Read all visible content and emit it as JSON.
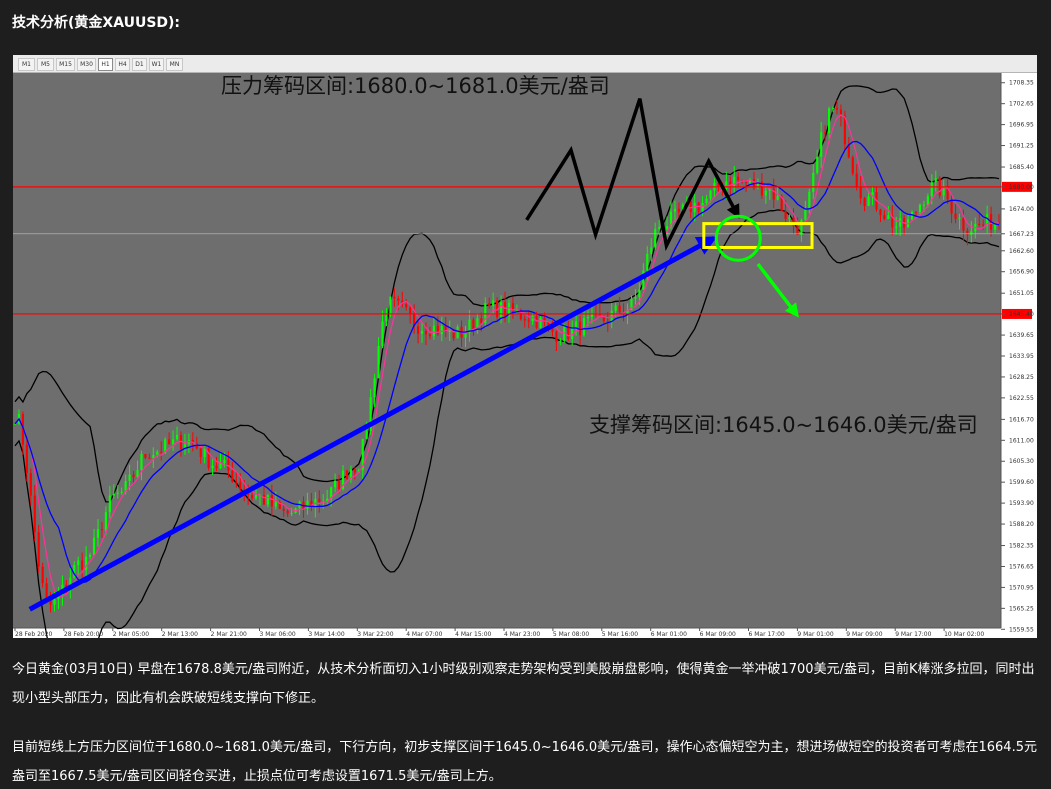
{
  "page": {
    "heading": "技术分析(黄金XAUUSD):",
    "paragraph1": "今日黄金(03月10日) 早盘在1678.8美元/盎司附近，从技术分析面切入1小时级别观察走势架构受到美股崩盘影响，使得黄金一举冲破1700美元/盎司，目前K棒涨多拉回，同时出现小型头部压力，因此有机会跌破短线支撑向下修正。",
    "paragraph2": "目前短线上方压力区间位于1680.0~1681.0美元/盎司，下行方向，初步支撑区间于1645.0~1646.0美元/盎司，操作心态偏短空为主，想进场做短空的投资者可考虑在1664.5元盎司至1667.5美元/盎司区间轻仓买进，止损点位可考虑设置1671.5美元/盎司上方。"
  },
  "timeframes": [
    "M1",
    "M5",
    "M15",
    "M30",
    "H1",
    "H4",
    "D1",
    "W1",
    "MN"
  ],
  "active_timeframe": "H1",
  "colors": {
    "chart_bg": "#6e6e6e",
    "bull": "#00ff00",
    "bear": "#ff0000",
    "ma_fast": "#ff3399",
    "ma_mid": "#0000ff",
    "bands": "#000000",
    "resistance_line": "#ff0000",
    "support_line": "#ff0000",
    "trend_arrow": "#0000ff",
    "box": "#ffff00",
    "circle": "#00ff00",
    "zigzag": "#000000"
  },
  "chart_data": {
    "type": "candlestick",
    "symbol": "XAUUSD",
    "timeframe": "H1",
    "ylim": [
      1559.9,
      1711.0
    ],
    "y_ticks": [
      "1708.35",
      "1702.65",
      "1696.95",
      "1691.25",
      "1685.40",
      "1680.00",
      "1674.00",
      "1667.23",
      "1662.60",
      "1656.90",
      "1651.05",
      "1645.40",
      "1639.65",
      "1633.95",
      "1628.25",
      "1622.55",
      "1616.70",
      "1611.00",
      "1605.30",
      "1599.60",
      "1593.90",
      "1588.20",
      "1582.35",
      "1576.65",
      "1570.95",
      "1565.25",
      "1559.55"
    ],
    "x_ticks": [
      "28 Feb 2020",
      "28 Feb 20:00",
      "2 Mar 05:00",
      "2 Mar 13:00",
      "2 Mar 21:00",
      "3 Mar 06:00",
      "3 Mar 14:00",
      "3 Mar 22:00",
      "4 Mar 07:00",
      "4 Mar 15:00",
      "4 Mar 23:00",
      "5 Mar 08:00",
      "5 Mar 16:00",
      "6 Mar 01:00",
      "6 Mar 09:00",
      "6 Mar 17:00",
      "9 Mar 01:00",
      "9 Mar 09:00",
      "9 Mar 17:00",
      "10 Mar 02:00"
    ],
    "current_price": 1667.23,
    "resistance_level": 1680.0,
    "support_level": 1645.4,
    "resistance_label": "压力筹码区间:1680.0~1681.0美元/盎司",
    "support_label": "支撑筹码区间:1645.0~1646.0美元/盎司",
    "price_anchors": [
      1618,
      1566,
      1578,
      1596,
      1608,
      1611,
      1604,
      1596,
      1591,
      1595,
      1604,
      1648,
      1642,
      1640,
      1647,
      1645,
      1640,
      1643,
      1647,
      1670,
      1675,
      1682,
      1680,
      1669,
      1701,
      1677,
      1669,
      1680,
      1669,
      1671
    ],
    "box_range": [
      1663.5,
      1670.0
    ],
    "box_span": [
      0.7,
      0.81
    ]
  }
}
